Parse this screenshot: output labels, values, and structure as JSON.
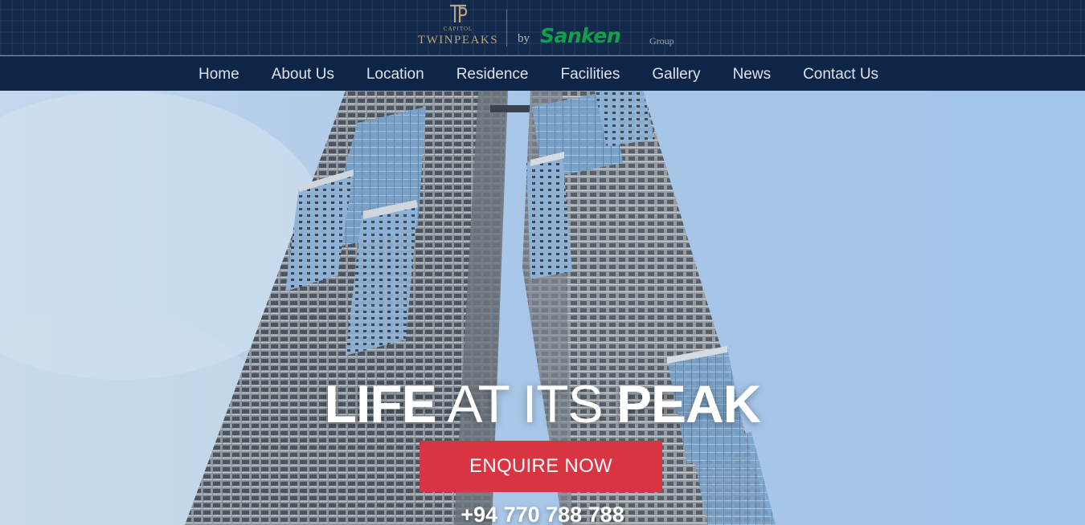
{
  "brand": {
    "monogram": "TP",
    "capitol": "CAPITOL",
    "name": "TWINPEAKS",
    "by": "by",
    "developer": "Sanken",
    "developer_suffix": "Group"
  },
  "nav": {
    "items": [
      {
        "label": "Home"
      },
      {
        "label": "About Us"
      },
      {
        "label": "Location"
      },
      {
        "label": "Residence"
      },
      {
        "label": "Facilities"
      },
      {
        "label": "Gallery"
      },
      {
        "label": "News"
      },
      {
        "label": "Contact Us"
      }
    ]
  },
  "hero": {
    "headline": {
      "word1": "LIFE",
      "word2": " AT ITS ",
      "word3": "PEAK"
    },
    "cta_label": "ENQUIRE NOW",
    "phone": "+94 770 788 788"
  },
  "colors": {
    "header_bg": "#13294b",
    "nav_bg": "#0f2547",
    "gold": "#b9a57d",
    "sanken_green": "#13a04a",
    "cta_red": "#d93442",
    "sky": "#a4c3e6"
  },
  "icons": {
    "logo": "twinpeaks-monogram-icon"
  }
}
